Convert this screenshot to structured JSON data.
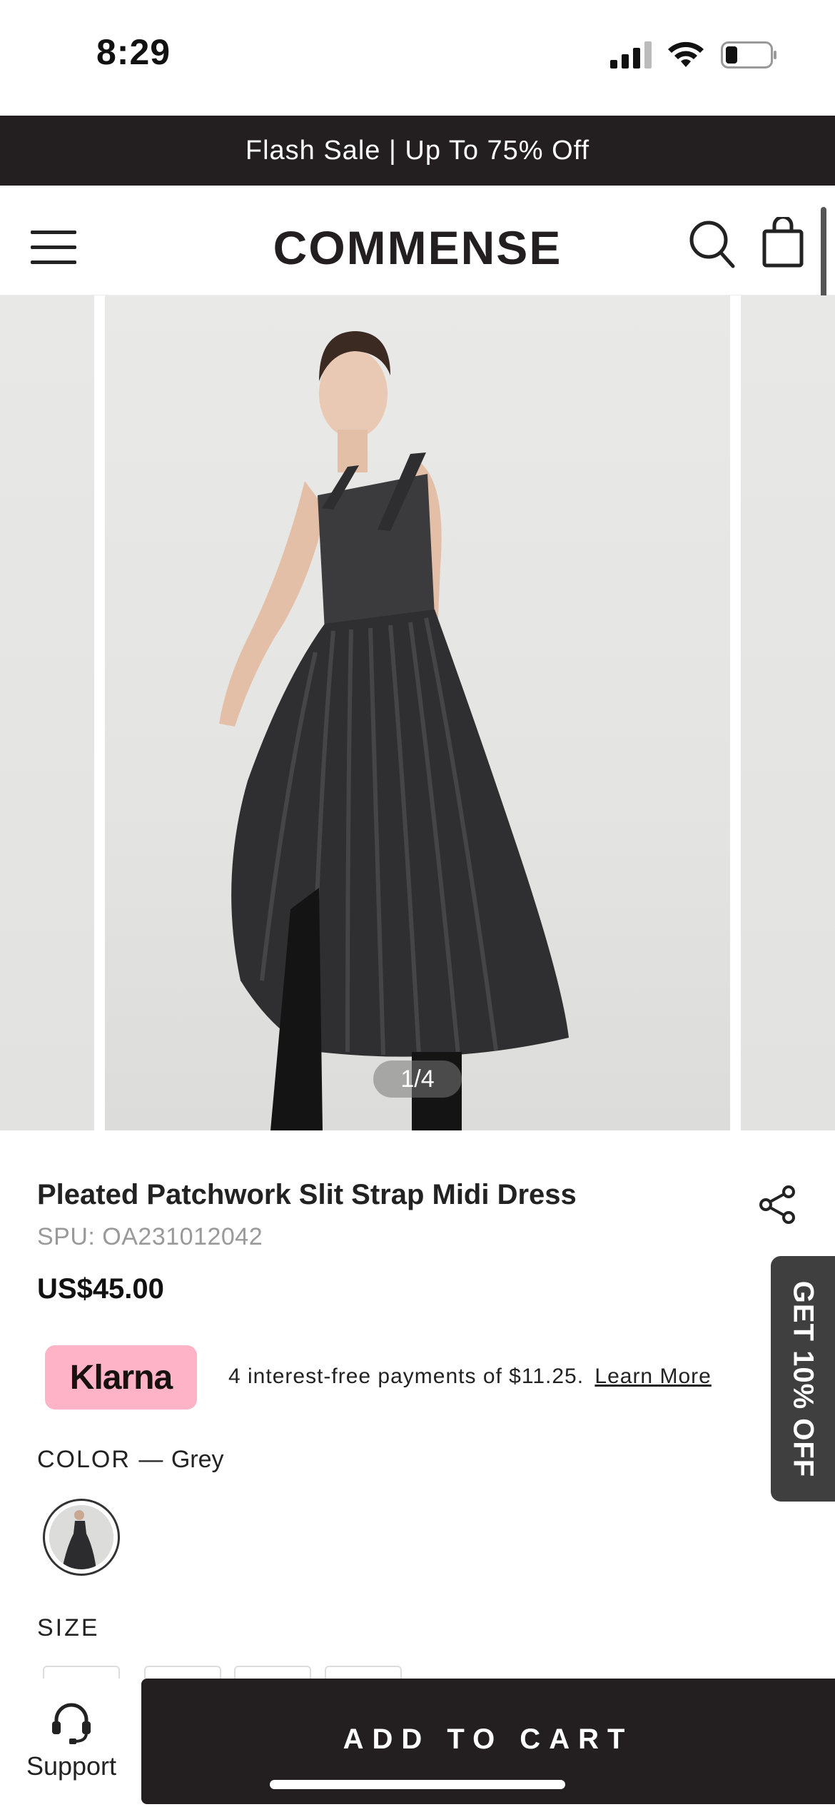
{
  "status_bar": {
    "time": "8:29",
    "icons": [
      "cellular-signal-icon",
      "wifi-icon",
      "battery-icon"
    ]
  },
  "promo_banner": {
    "text": "Flash Sale | Up To 75% Off"
  },
  "header": {
    "logo_text": "COMMENSE",
    "icons": [
      "menu-icon",
      "search-icon",
      "shopping-bag-icon"
    ]
  },
  "gallery": {
    "counter": "1/4",
    "current_index": 1,
    "total": 4
  },
  "product": {
    "title": "Pleated Patchwork Slit Strap Midi Dress",
    "spu": "SPU: OA231012042",
    "price": "US$45.00"
  },
  "klarna": {
    "badge": "Klarna",
    "text": "4 interest-free payments of $11.25.",
    "link": "Learn More"
  },
  "side_promo": {
    "text": "GET 10% OFF"
  },
  "color": {
    "label": "COLOR",
    "separator": "—",
    "value": "Grey"
  },
  "size": {
    "label": "SIZE"
  },
  "bottom_bar": {
    "support_label": "Support",
    "add_to_cart": "ADD TO CART"
  },
  "colors": {
    "dark": "#231f20",
    "klarna_pink": "#ffb3c7",
    "side_promo_bg": "#3f3f3f"
  }
}
